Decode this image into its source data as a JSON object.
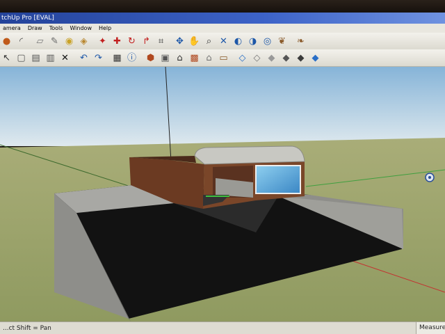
{
  "window": {
    "title": "tchUp Pro [EVAL]"
  },
  "menu": [
    "amera",
    "Draw",
    "Tools",
    "Window",
    "Help"
  ],
  "toolbar_row1": [
    {
      "name": "circle-tool-icon",
      "glyph": "●",
      "color": "#c05a1a"
    },
    {
      "name": "arc-tool-icon",
      "glyph": "◜",
      "color": "#444444"
    },
    {
      "name": "eraser-icon",
      "glyph": "▱",
      "color": "#777777"
    },
    {
      "name": "pencil-icon",
      "glyph": "✎",
      "color": "#666666"
    },
    {
      "name": "tape-measure-icon",
      "glyph": "◉",
      "color": "#c9a227"
    },
    {
      "name": "paint-bucket-icon",
      "glyph": "◈",
      "color": "#b8862e"
    },
    {
      "name": "push-pull-icon",
      "glyph": "✦",
      "color": "#c21f1f"
    },
    {
      "name": "move-icon",
      "glyph": "✚",
      "color": "#c21f1f"
    },
    {
      "name": "rotate-icon",
      "glyph": "↻",
      "color": "#c21f1f"
    },
    {
      "name": "follow-me-icon",
      "glyph": "↱",
      "color": "#c21f1f"
    },
    {
      "name": "offset-icon",
      "glyph": "⌗",
      "color": "#333333"
    },
    {
      "name": "orbit-icon",
      "glyph": "✥",
      "color": "#1d57a8"
    },
    {
      "name": "pan-hand-icon",
      "glyph": "✋",
      "color": "#333333"
    },
    {
      "name": "zoom-icon",
      "glyph": "⌕",
      "color": "#333333"
    },
    {
      "name": "zoom-extents-icon",
      "glyph": "✕",
      "color": "#1d57a8"
    },
    {
      "name": "previous-view-icon",
      "glyph": "◐",
      "color": "#1d57a8"
    },
    {
      "name": "next-view-icon",
      "glyph": "◑",
      "color": "#1d57a8"
    },
    {
      "name": "position-camera-icon",
      "glyph": "◎",
      "color": "#1d57a8"
    },
    {
      "name": "walk-icon",
      "glyph": "❦",
      "color": "#8a5a2a"
    },
    {
      "name": "look-around-icon",
      "glyph": "❧",
      "color": "#8a5a2a"
    }
  ],
  "toolbar_row2": [
    {
      "name": "select-arrow-icon",
      "glyph": "↖",
      "color": "#333333"
    },
    {
      "name": "new-file-icon",
      "glyph": "▢",
      "color": "#555555"
    },
    {
      "name": "open-file-icon",
      "glyph": "▤",
      "color": "#555555"
    },
    {
      "name": "save-file-icon",
      "glyph": "▥",
      "color": "#555555"
    },
    {
      "name": "delete-icon",
      "glyph": "✕",
      "color": "#111111"
    },
    {
      "name": "undo-icon",
      "glyph": "↶",
      "color": "#1d57a8"
    },
    {
      "name": "redo-icon",
      "glyph": "↷",
      "color": "#1d57a8"
    },
    {
      "name": "print-icon",
      "glyph": "▦",
      "color": "#333333"
    },
    {
      "name": "model-info-icon",
      "glyph": "ⓘ",
      "color": "#1d57a8"
    },
    {
      "name": "iso-view-icon",
      "glyph": "⬢",
      "color": "#b0481f"
    },
    {
      "name": "top-view-icon",
      "glyph": "▣",
      "color": "#555555"
    },
    {
      "name": "front-view-icon",
      "glyph": "⌂",
      "color": "#333333"
    },
    {
      "name": "right-view-icon",
      "glyph": "▩",
      "color": "#b0481f"
    },
    {
      "name": "back-view-icon",
      "glyph": "⌂",
      "color": "#777777"
    },
    {
      "name": "left-view-icon",
      "glyph": "▭",
      "color": "#8a5a2a"
    },
    {
      "name": "xray-style-icon",
      "glyph": "◇",
      "color": "#2a6fc7"
    },
    {
      "name": "wireframe-style-icon",
      "glyph": "◇",
      "color": "#777777"
    },
    {
      "name": "hidden-line-style-icon",
      "glyph": "◆",
      "color": "#999999"
    },
    {
      "name": "shaded-style-icon",
      "glyph": "◆",
      "color": "#555555"
    },
    {
      "name": "shaded-textures-style-icon",
      "glyph": "◆",
      "color": "#3b3b3b"
    },
    {
      "name": "monochrome-style-icon",
      "glyph": "◆",
      "color": "#2a6fc7"
    }
  ],
  "statusbar": {
    "hint": "...ct  Shift = Pan",
    "measurements_label": "Measure"
  }
}
